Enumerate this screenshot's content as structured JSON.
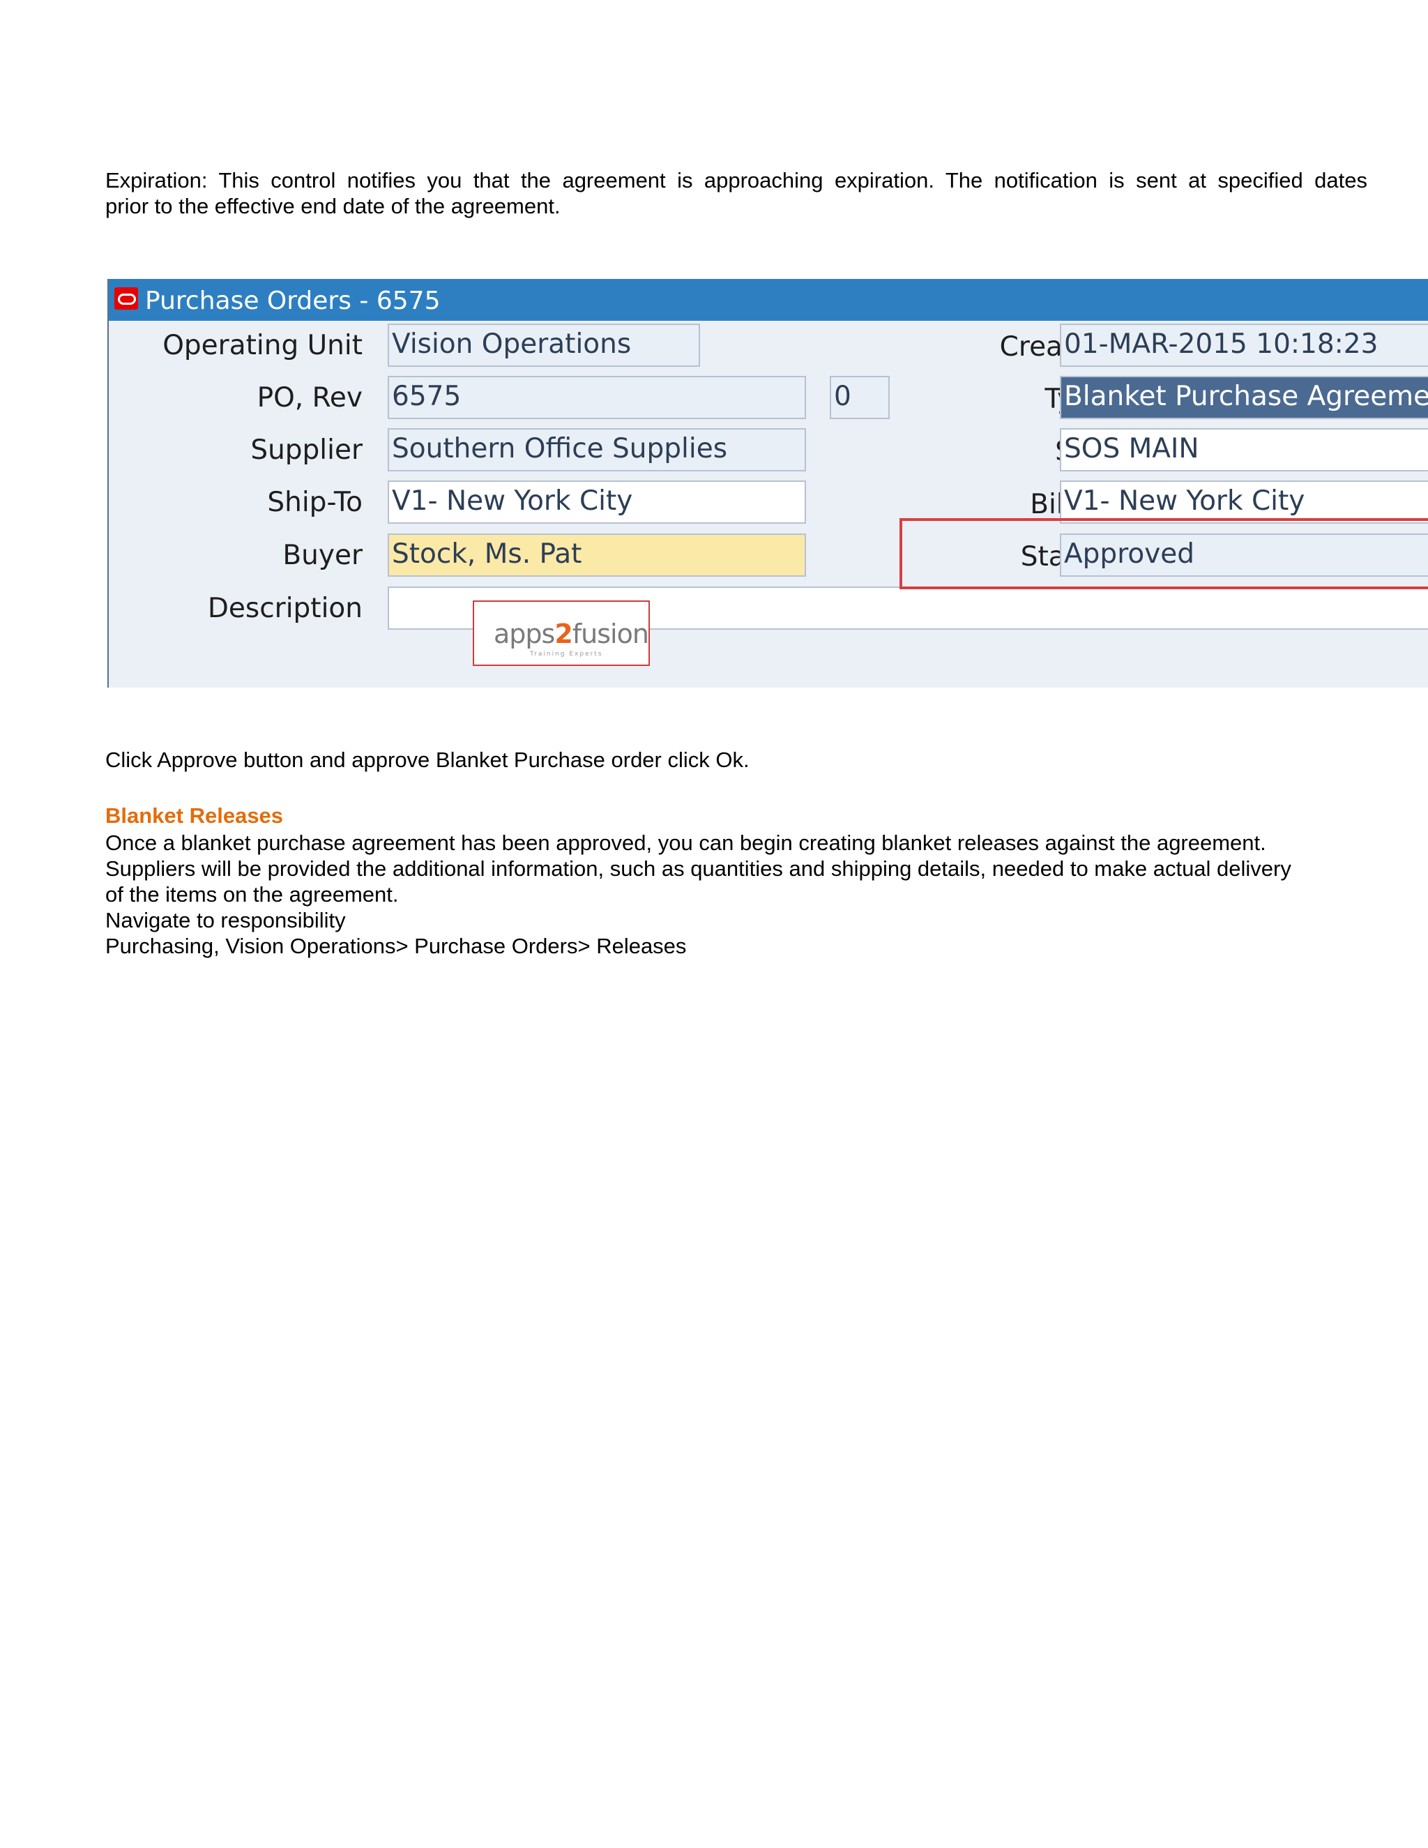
{
  "intro": {
    "line1": "Expiration: This control notifies you that the agreement is approaching expiration. The notification is sent at specified dates",
    "line2": "prior to the effective end date of the agreement."
  },
  "form": {
    "title": "Purchase Orders - 6575",
    "operating_unit": {
      "label": "Operating Unit",
      "value": "Vision Operations"
    },
    "po_rev": {
      "label": "PO, Rev",
      "po": "6575",
      "rev": "0"
    },
    "supplier": {
      "label": "Supplier",
      "value": "Southern Office Supplies"
    },
    "ship_to": {
      "label": "Ship-To",
      "value": "V1- New York City"
    },
    "buyer": {
      "label": "Buyer",
      "value": "Stock, Ms. Pat"
    },
    "description": {
      "label": "Description",
      "value": ""
    },
    "created": {
      "label": "Created",
      "value": "01-MAR-2015 10:18:23"
    },
    "type": {
      "label": "Type",
      "value": "Blanket Purchase Agreemen"
    },
    "site": {
      "label": "Site",
      "value": "SOS MAIN"
    },
    "bill_to": {
      "label": "Bill-To",
      "value": "V1- New York City"
    },
    "status": {
      "label": "Status",
      "value": "Approved"
    },
    "watermark": {
      "brand_pre": "apps",
      "brand_num": "2",
      "brand_post": "fusion",
      "tagline": "Training Experts"
    }
  },
  "click_instruction": "Click Approve button and approve Blanket Purchase order click Ok.",
  "releases": {
    "heading": "Blanket Releases",
    "lines": [
      "Once a blanket purchase agreement has been approved, you can begin creating blanket releases against the agreement.",
      "Suppliers will be provided the additional information, such as quantities and shipping details, needed to make actual delivery",
      "of the items on the agreement.",
      "Navigate to responsibility",
      "Purchasing, Vision Operations> Purchase Orders> Releases"
    ]
  },
  "colors": {
    "title_bar": "#2e7fc2",
    "heading": "#e46c0a",
    "highlight_box": "#d93f3f",
    "buyer_field": "#fbe9a7"
  }
}
